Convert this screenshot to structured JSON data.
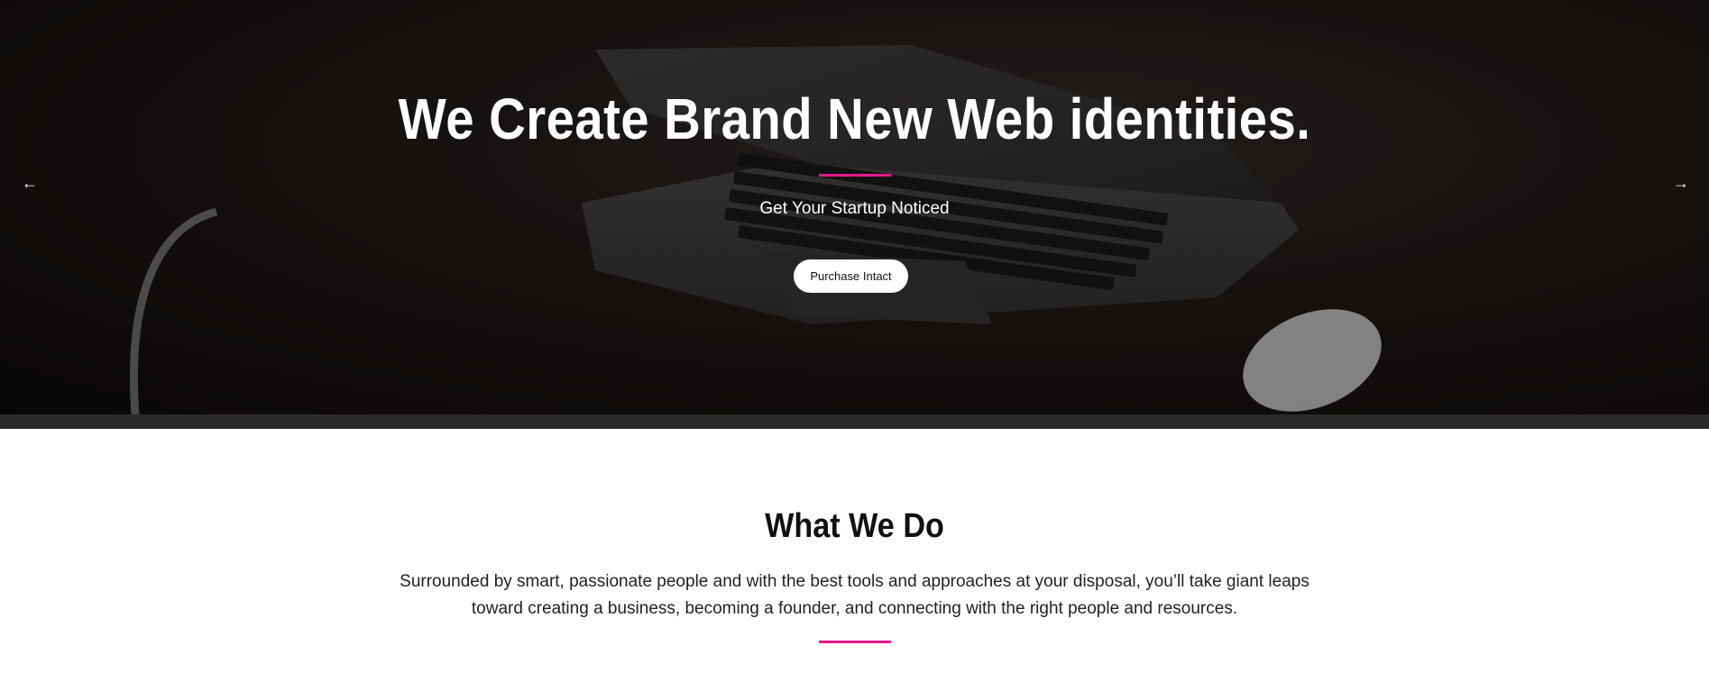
{
  "hero": {
    "title": "We Create Brand New Web identities.",
    "subtitle": "Get Your Startup Noticed",
    "cta_label": "Purchase Intact",
    "prev_icon": "←",
    "next_icon": "→",
    "accent_color": "#e5198c"
  },
  "what_we_do": {
    "title": "What We Do",
    "text": "Surrounded by smart, passionate people and with the best tools and approaches at your disposal, you’ll take giant leaps toward creating a business, becoming a founder, and connecting with the right people and resources."
  },
  "icons": {
    "prev": "arrow-left-icon",
    "next": "arrow-right-icon"
  }
}
